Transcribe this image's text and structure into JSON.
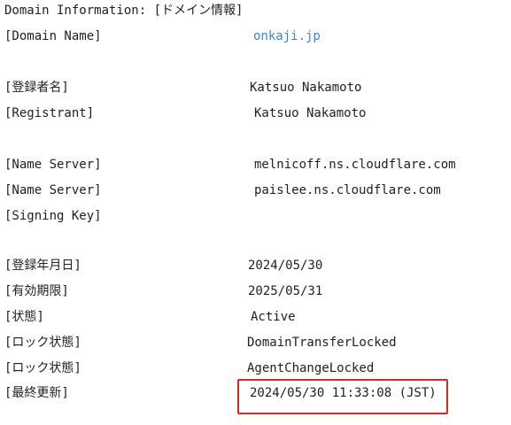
{
  "header": {
    "text": "Domain Information: [ドメイン情報]"
  },
  "colors": {
    "link": "#3a87c6",
    "highlight_border": "#d9262a",
    "text": "#1f1f1f"
  },
  "rows": {
    "domain_name": {
      "label": "[Domain Name]",
      "value": "onkaji.jp"
    },
    "registrant_jp": {
      "label": "[登録者名]",
      "value": "Katsuo Nakamoto"
    },
    "registrant_en": {
      "label": "[Registrant]",
      "value": "Katsuo Nakamoto"
    },
    "name_server_1": {
      "label": "[Name Server]",
      "value": "melnicoff.ns.cloudflare.com"
    },
    "name_server_2": {
      "label": "[Name Server]",
      "value": "paislee.ns.cloudflare.com"
    },
    "signing_key": {
      "label": "[Signing Key]",
      "value": ""
    },
    "registered_date": {
      "label": "[登録年月日]",
      "value": "2024/05/30"
    },
    "expiration_date": {
      "label": "[有効期限]",
      "value": "2025/05/31"
    },
    "status": {
      "label": "[状態]",
      "value": "Active"
    },
    "lock_status_1": {
      "label": "[ロック状態]",
      "value": "DomainTransferLocked"
    },
    "lock_status_2": {
      "label": "[ロック状態]",
      "value": "AgentChangeLocked"
    },
    "last_updated": {
      "label": "[最終更新]",
      "value": "2024/05/30 11:33:08 (JST)"
    }
  }
}
